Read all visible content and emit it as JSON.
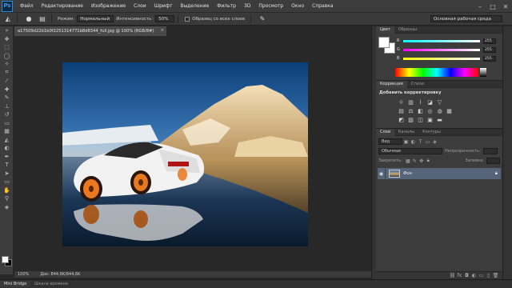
{
  "app": {
    "logo": "Ps"
  },
  "menu": [
    "Файл",
    "Редактирование",
    "Изображение",
    "Слои",
    "Шрифт",
    "Выделение",
    "Фильтр",
    "3D",
    "Просмотр",
    "Окно",
    "Справка"
  ],
  "window_controls": [
    "–",
    "□",
    "✕"
  ],
  "options": {
    "mode_label": "Режим:",
    "mode_value": "Нормальный",
    "intensity_label": "Интенсивность:",
    "intensity_value": "50%",
    "sample_all_label": "Образец со всех слоев",
    "workspace": "Основная рабочая среда"
  },
  "document": {
    "tab_title": "a17509d22b1b0f2251314771b8d8344_full.jpg @ 100% (RGB/8#)",
    "close": "×",
    "zoom": "100%",
    "doc_info": "Док: 844,6K/844,6K"
  },
  "color_panel": {
    "tabs": [
      "Цвет",
      "Образцы"
    ],
    "channels": [
      {
        "name": "R",
        "value": "255"
      },
      {
        "name": "G",
        "value": "255"
      },
      {
        "name": "B",
        "value": "255"
      }
    ],
    "colors": {
      "fg": "#ffffff",
      "bg": "#ffffff"
    }
  },
  "adjustments": {
    "tabs": [
      "Коррекция",
      "Стили"
    ],
    "title": "Добавить корректировку"
  },
  "layers": {
    "tabs": [
      "Слои",
      "Каналы",
      "Контуры"
    ],
    "kind": "Вид",
    "blend_mode": "Обычные",
    "opacity_label": "Непрозрачность:",
    "lock_label": "Закрепить:",
    "fill_label": "Заливка:",
    "items": [
      {
        "name": "Фон",
        "visible": true,
        "locked": true
      }
    ]
  },
  "bottom_tabs": [
    "Mini Bridge",
    "Шкала времени"
  ]
}
